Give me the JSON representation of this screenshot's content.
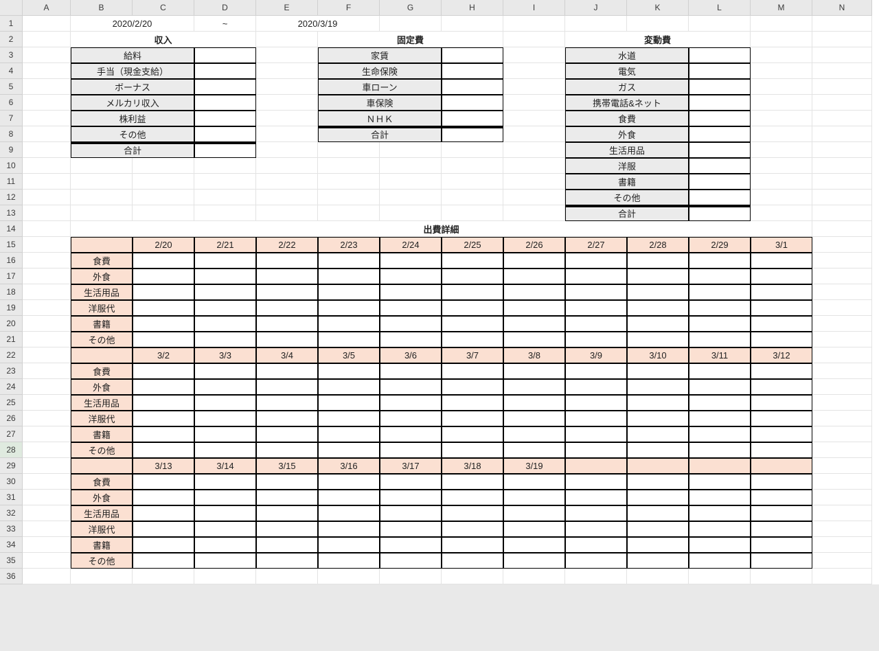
{
  "column_letters": [
    "A",
    "B",
    "C",
    "D",
    "E",
    "F",
    "G",
    "H",
    "I",
    "J",
    "K",
    "L",
    "M",
    "N"
  ],
  "row_numbers": [
    "1",
    "2",
    "3",
    "4",
    "5",
    "6",
    "7",
    "8",
    "9",
    "10",
    "11",
    "12",
    "13",
    "14",
    "15",
    "16",
    "17",
    "18",
    "19",
    "20",
    "21",
    "22",
    "23",
    "24",
    "25",
    "26",
    "27",
    "28",
    "29",
    "30",
    "31",
    "32",
    "33",
    "34",
    "35",
    "36"
  ],
  "selected_row": "28",
  "dates": {
    "start": "2020/2/20",
    "tilde": "~",
    "end": "2020/3/19"
  },
  "income": {
    "title": "収入",
    "rows": [
      "給料",
      "手当（現金支給）",
      "ボーナス",
      "メルカリ収入",
      "株利益",
      "その他"
    ],
    "total_label": "合計"
  },
  "fixed": {
    "title": "固定費",
    "rows": [
      "家賃",
      "生命保険",
      "車ローン",
      "車保険",
      "ＮＨＫ"
    ],
    "total_label": "合計"
  },
  "variable": {
    "title": "変動費",
    "rows": [
      "水道",
      "電気",
      "ガス",
      "携帯電話&ネット",
      "食費",
      "外食",
      "生活用品",
      "洋服",
      "書籍",
      "その他"
    ],
    "total_label": "合計"
  },
  "detail": {
    "title": "出費詳細",
    "categories": [
      "食費",
      "外食",
      "生活用品",
      "洋服代",
      "書籍",
      "その他"
    ],
    "date_rows": [
      [
        "2/20",
        "2/21",
        "2/22",
        "2/23",
        "2/24",
        "2/25",
        "2/26",
        "2/27",
        "2/28",
        "2/29",
        "3/1"
      ],
      [
        "3/2",
        "3/3",
        "3/4",
        "3/5",
        "3/6",
        "3/7",
        "3/8",
        "3/9",
        "3/10",
        "3/11",
        "3/12"
      ],
      [
        "3/13",
        "3/14",
        "3/15",
        "3/16",
        "3/17",
        "3/18",
        "3/19",
        "",
        "",
        "",
        ""
      ]
    ]
  }
}
